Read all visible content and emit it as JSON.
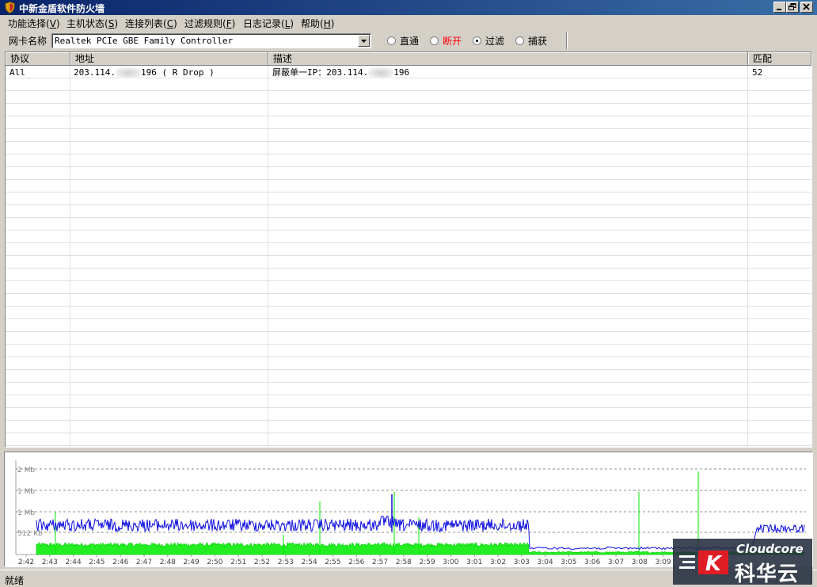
{
  "window": {
    "title": "中新金盾软件防火墙",
    "controls": [
      "minimize-icon",
      "restore-icon",
      "close-icon"
    ]
  },
  "menu": [
    {
      "label": "功能选择(",
      "key": "V",
      "end": ")"
    },
    {
      "label": "主机状态(",
      "key": "S",
      "end": ")"
    },
    {
      "label": "连接列表(",
      "key": "C",
      "end": ")"
    },
    {
      "label": "过滤规则(",
      "key": "F",
      "end": ")"
    },
    {
      "label": "日志记录(",
      "key": "L",
      "end": ")"
    },
    {
      "label": "帮助(",
      "key": "H",
      "end": ")"
    }
  ],
  "toolbar": {
    "nic_label": "网卡名称",
    "nic_value": "Realtek PCIe GBE Family Controller",
    "modes": [
      {
        "label": "直通",
        "checked": false,
        "color": "#000000"
      },
      {
        "label": "断开",
        "checked": false,
        "color": "#ff0000"
      },
      {
        "label": "过滤",
        "checked": true,
        "color": "#000000"
      },
      {
        "label": "捕获",
        "checked": false,
        "color": "#000000"
      }
    ]
  },
  "table": {
    "columns": [
      "协议",
      "地址",
      "描述",
      "匹配"
    ],
    "rows": [
      {
        "protocol": "All",
        "addr_a": "203.114.",
        "addr_b": "196 ( R Drop )",
        "desc_a": "屏蔽单一IP：203.114.",
        "desc_b": "196",
        "match": "52"
      }
    ]
  },
  "chart_data": {
    "type": "line",
    "y_ticks": [
      "2 Mb",
      "1 Mb",
      "1 Mb",
      "512 Kb"
    ],
    "x_ticks": [
      "2:42",
      "2:43",
      "2:44",
      "2:45",
      "2:46",
      "2:47",
      "2:48",
      "2:49",
      "2:50",
      "2:51",
      "2:52",
      "2:53",
      "2:54",
      "2:55",
      "2:56",
      "2:57",
      "2:58",
      "2:59",
      "3:00",
      "3:01",
      "3:02",
      "3:03",
      "3:04",
      "3:05",
      "3:06",
      "3:07",
      "3:08",
      "3:09"
    ],
    "grid": true,
    "series": [
      {
        "color": "#0000ff"
      },
      {
        "color": "#00ff00"
      }
    ]
  },
  "status": {
    "text": "就绪"
  },
  "watermark": {
    "en": "Cloudcore",
    "cn": "科华云",
    "letter": "K"
  }
}
